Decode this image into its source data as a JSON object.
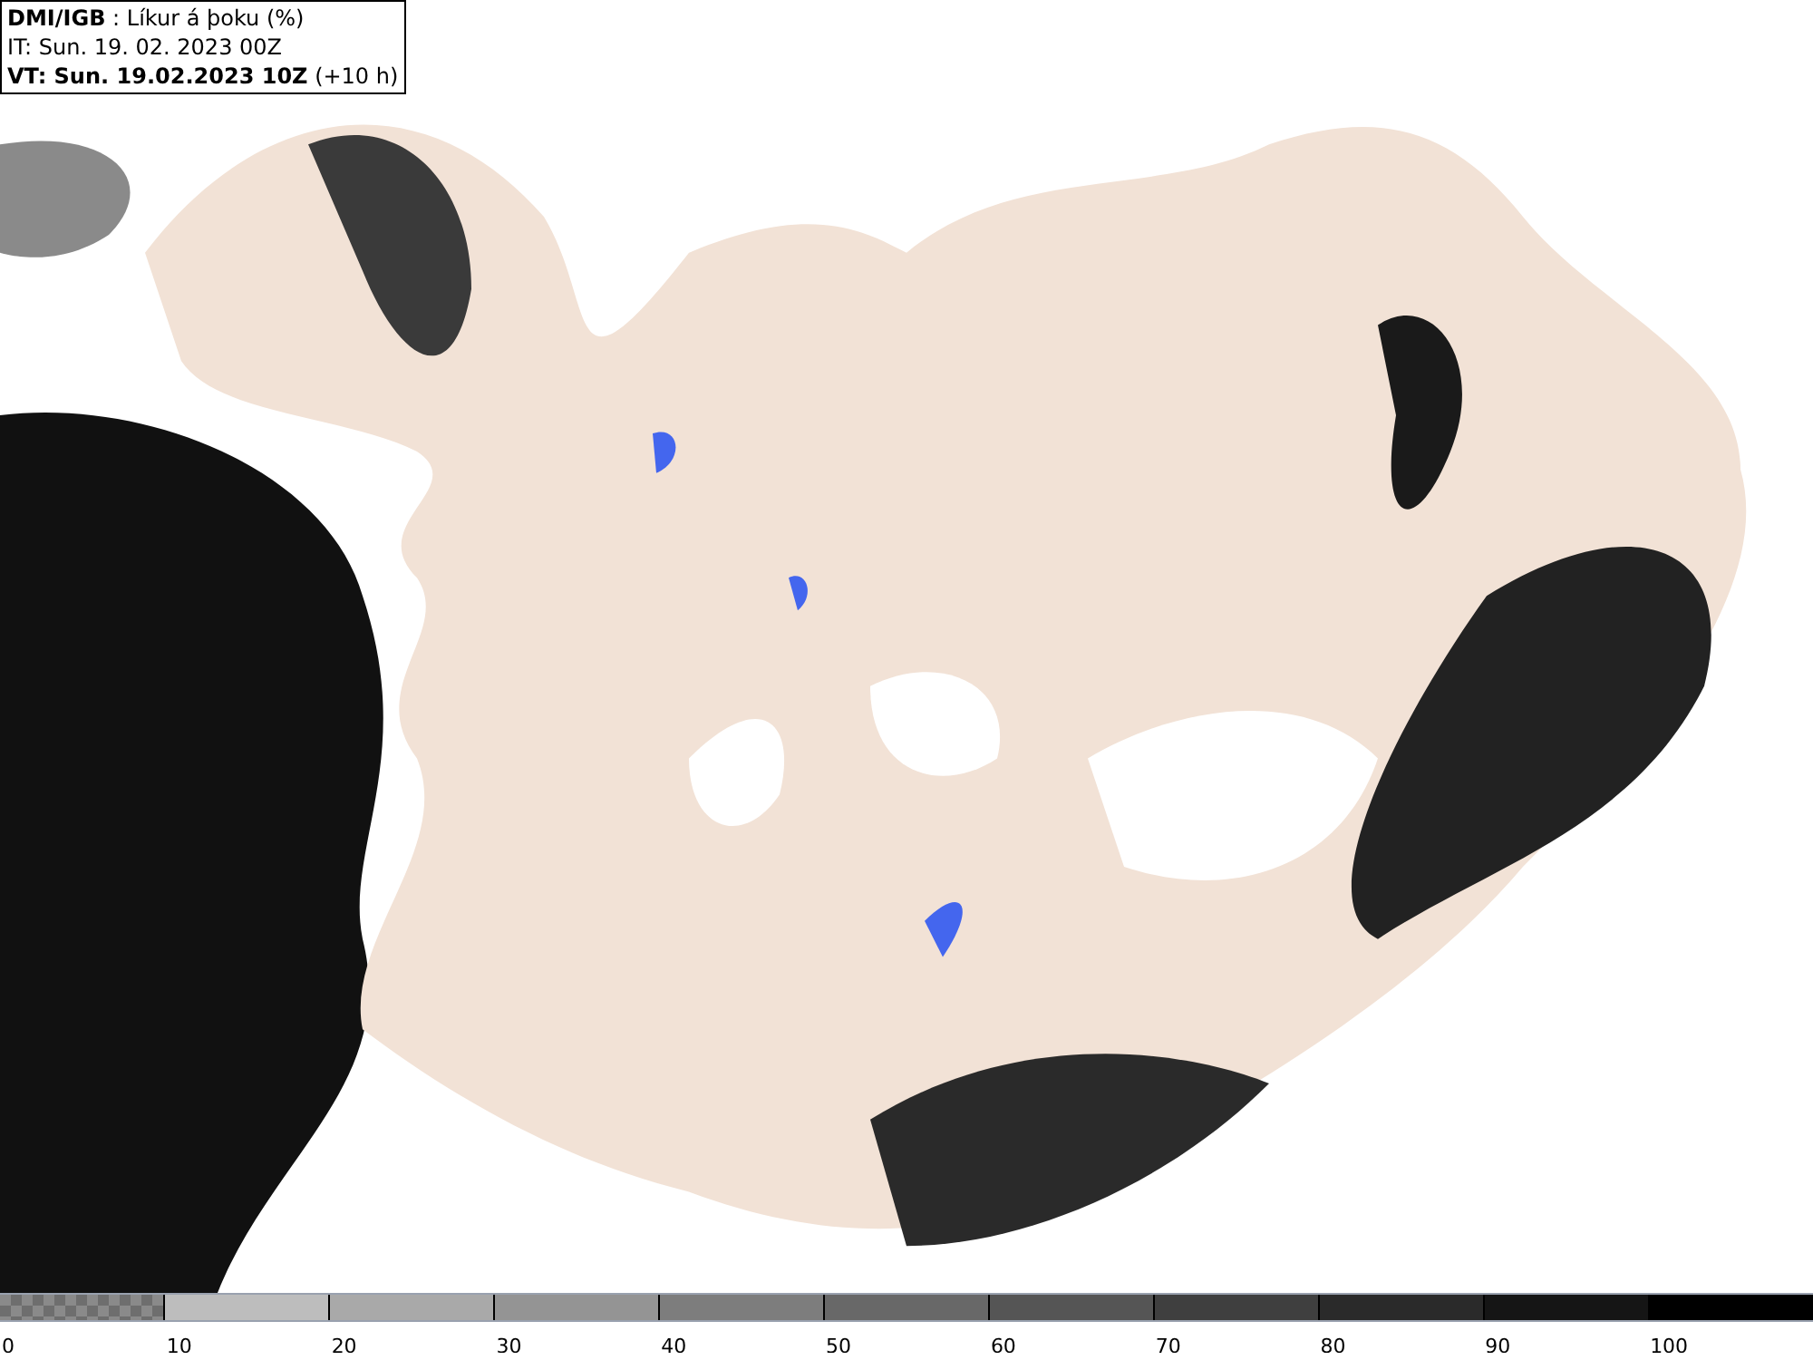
{
  "header": {
    "lines": [
      "**DMI/IGB** : Líkur á þoku (%)",
      "IT: Sun. 19. 02. 2023 00Z",
      "**VT: Sun. 19.02.2023 10Z** (+10 h)"
    ]
  },
  "legend": {
    "bins": [
      {
        "label": "0",
        "kind": "checker",
        "color": "#6e6e6e"
      },
      {
        "label": "10",
        "kind": "solid",
        "color": "#bdbdbd"
      },
      {
        "label": "20",
        "kind": "solid",
        "color": "#a9a9a9"
      },
      {
        "label": "30",
        "kind": "solid",
        "color": "#949494"
      },
      {
        "label": "40",
        "kind": "solid",
        "color": "#7d7d7d"
      },
      {
        "label": "50",
        "kind": "solid",
        "color": "#686868"
      },
      {
        "label": "60",
        "kind": "solid",
        "color": "#555555"
      },
      {
        "label": "70",
        "kind": "solid",
        "color": "#3f3f3f"
      },
      {
        "label": "80",
        "kind": "solid",
        "color": "#2a2a2a"
      },
      {
        "label": "90",
        "kind": "solid",
        "color": "#151515"
      },
      {
        "label": "100",
        "kind": "solid",
        "color": "#000000"
      }
    ]
  }
}
